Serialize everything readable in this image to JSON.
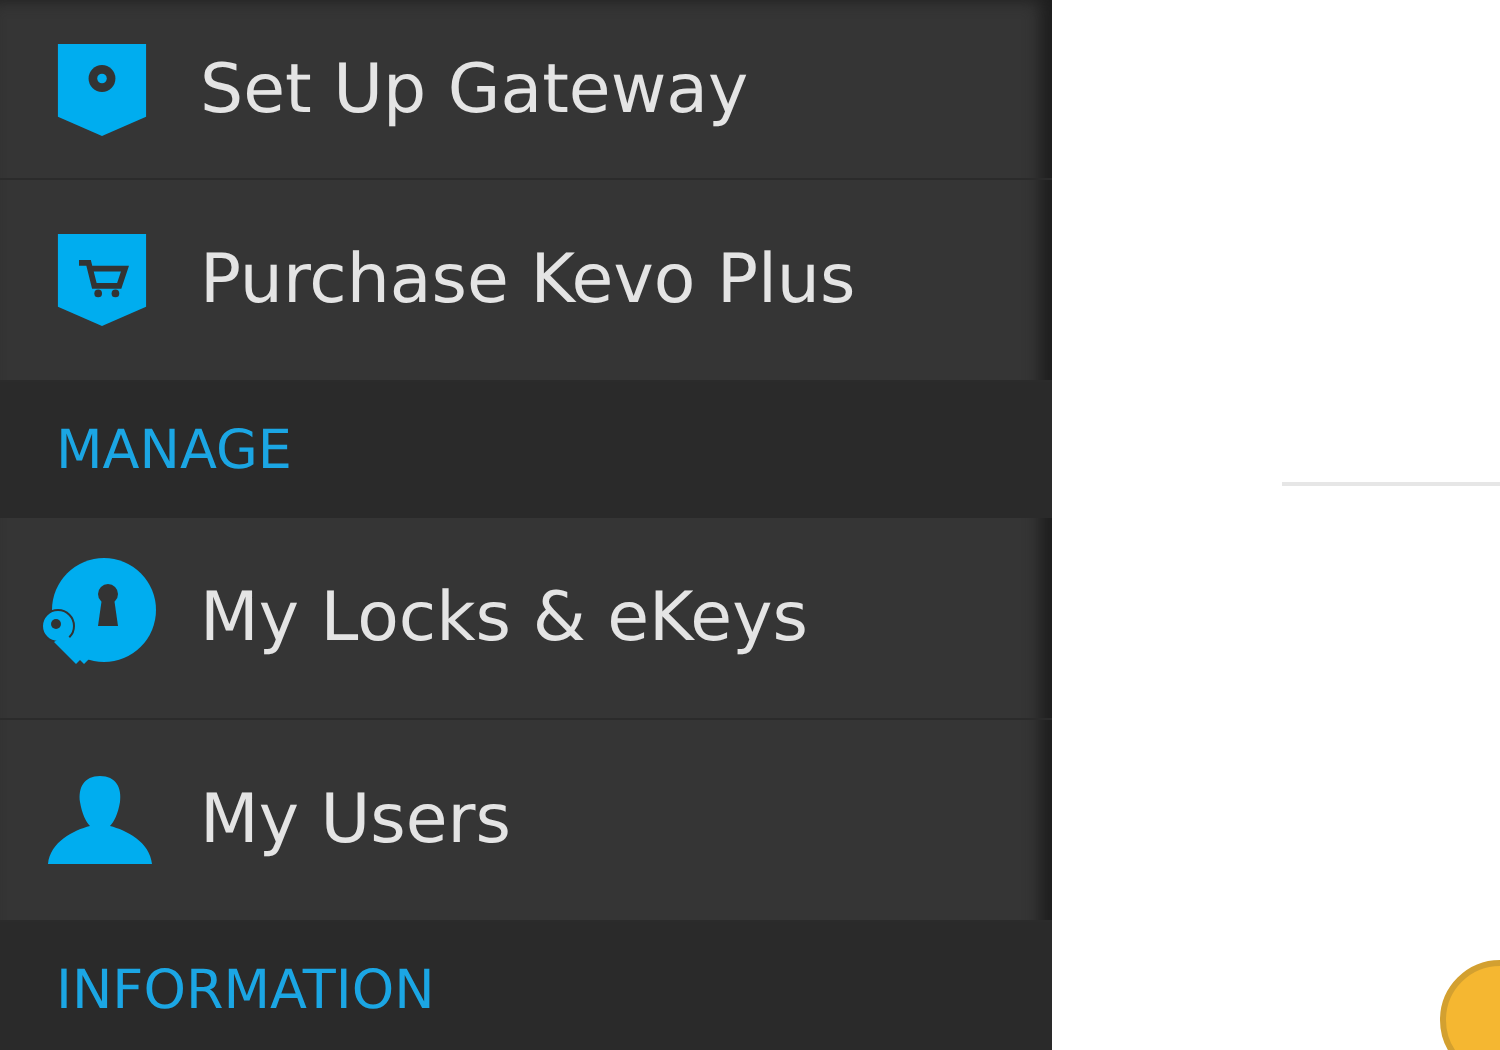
{
  "menu": [
    {
      "kind": "gateway",
      "label": "Set Up Gateway"
    },
    {
      "kind": "cart",
      "label": "Purchase Kevo Plus"
    },
    {
      "kind": "header",
      "label": "MANAGE"
    },
    {
      "kind": "locks",
      "label": "My Locks & eKeys"
    },
    {
      "kind": "user",
      "label": "My Users"
    },
    {
      "kind": "header",
      "label": "INFORMATION"
    }
  ]
}
